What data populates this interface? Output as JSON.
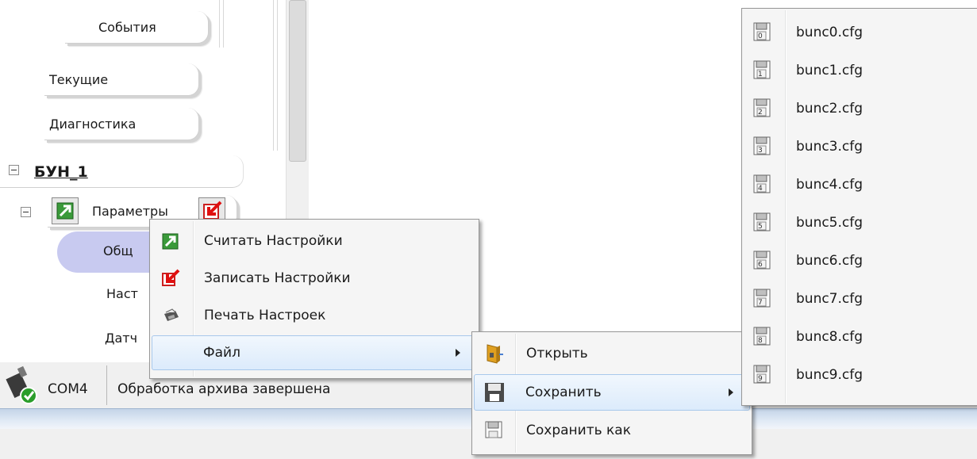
{
  "tree": {
    "events_label": "События",
    "current_label": "Текущие",
    "diagnostics_label": "Диагностика",
    "node_title": "БУН_1",
    "params_label": "Параметры",
    "general_partial": "Общ",
    "settings_partial": "Наст",
    "sensors_partial": "Датч"
  },
  "status": {
    "port": "COM4",
    "message": "Обработка архива завершена"
  },
  "context_menu": {
    "items": [
      {
        "label": "Считать Настройки",
        "icon": "read-settings-icon"
      },
      {
        "label": "Записать Настройки",
        "icon": "write-settings-icon"
      },
      {
        "label": "Печать Настроек",
        "icon": "printer-icon"
      },
      {
        "label": "Файл",
        "icon": ""
      }
    ]
  },
  "file_menu": {
    "items": [
      {
        "label": "Открыть",
        "icon": "open-file-icon"
      },
      {
        "label": "Сохранить",
        "icon": "save-icon"
      },
      {
        "label": "Сохранить как",
        "icon": "save-as-icon"
      }
    ]
  },
  "save_menu": {
    "items": [
      {
        "label": "bunc0.cfg",
        "slot": "0"
      },
      {
        "label": "bunc1.cfg",
        "slot": "1"
      },
      {
        "label": "bunc2.cfg",
        "slot": "2"
      },
      {
        "label": "bunc3.cfg",
        "slot": "3"
      },
      {
        "label": "bunc4.cfg",
        "slot": "4"
      },
      {
        "label": "bunc5.cfg",
        "slot": "5"
      },
      {
        "label": "bunc6.cfg",
        "slot": "6"
      },
      {
        "label": "bunc7.cfg",
        "slot": "7"
      },
      {
        "label": "bunc8.cfg",
        "slot": "8"
      },
      {
        "label": "bunc9.cfg",
        "slot": "9"
      }
    ]
  },
  "colors": {
    "highlight": "#dcebfc",
    "selected_node": "#c8caf0",
    "status_bar": "#f0f0f0"
  }
}
